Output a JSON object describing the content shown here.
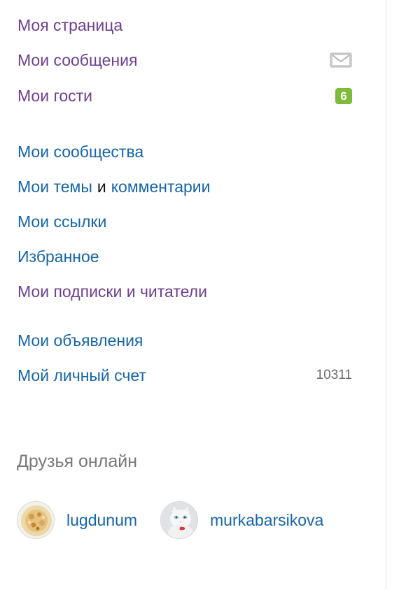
{
  "menu": {
    "my_page": "Моя страница",
    "my_messages": "Мои сообщения",
    "my_guests": "Мои гости",
    "guests_badge": "6",
    "my_communities": "Мои сообщества",
    "my_topics": "Мои темы",
    "conjunction": "и",
    "comments": "комментарии",
    "my_links": "Мои ссылки",
    "favorites": "Избранное",
    "subscriptions_readers": "Мои подписки и читатели",
    "my_ads": "Мои объявления",
    "personal_account": "Мой личный счет",
    "personal_account_value": "10311"
  },
  "friends_online": {
    "title": "Друзья онлайн",
    "users": [
      {
        "name": "lugdunum"
      },
      {
        "name": "murkabarsikova"
      }
    ]
  },
  "colors": {
    "visited_link": "#6e3f8e",
    "link": "#1565a9",
    "badge": "#7dbb3a",
    "muted": "#777777"
  },
  "icons": {
    "messages": "envelope-icon"
  }
}
